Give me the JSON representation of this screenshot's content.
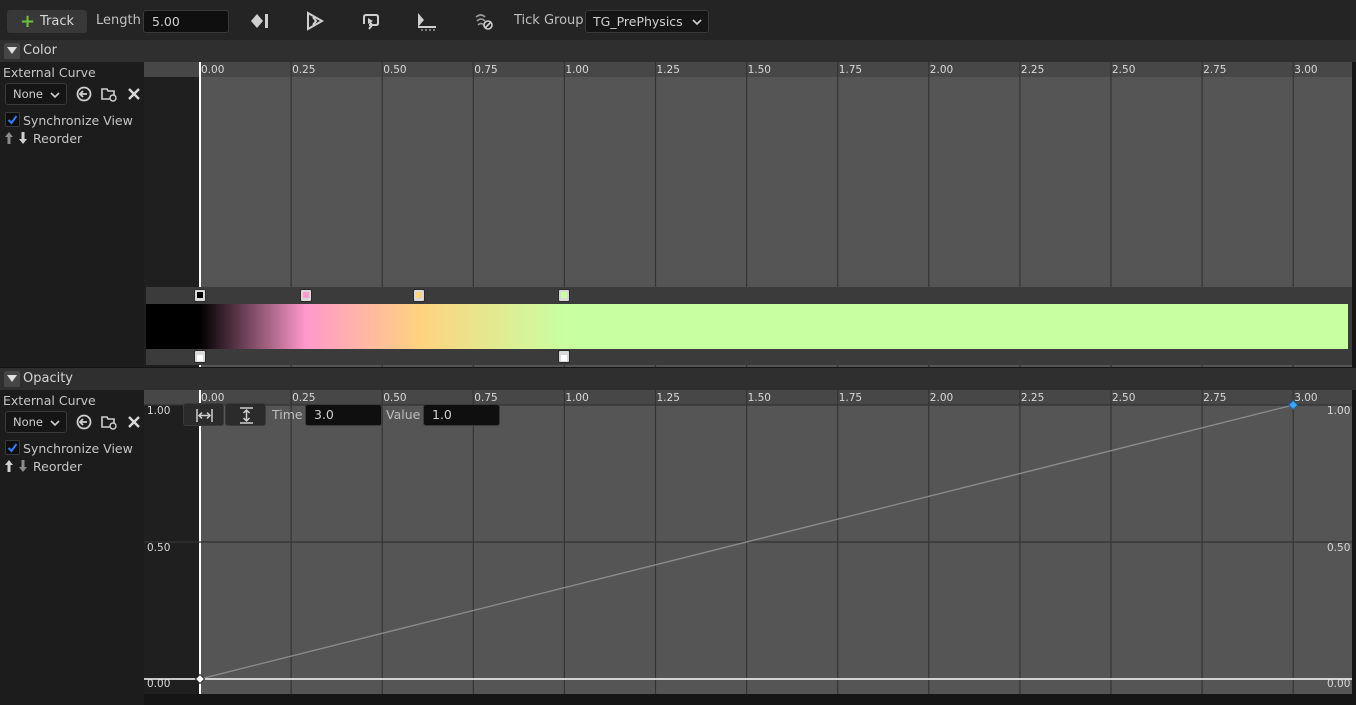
{
  "toolbar": {
    "track_label": "Track",
    "length_label": "Length",
    "length_value": "5.00",
    "tick_group_label": "Tick Group",
    "tick_group_value": "TG_PrePhysics",
    "icons": [
      "add-key-icon",
      "autoplay-icon",
      "loop-icon",
      "use-last-keyframe-icon",
      "ignore-time-dilation-icon"
    ]
  },
  "sections": {
    "color": {
      "title": "Color",
      "external_curve_label": "External Curve",
      "curve_value": "None",
      "sync_label": "Synchronize View",
      "sync_checked": true,
      "reorder_label": "Reorder",
      "gradient_stops": [
        {
          "time": 0.0,
          "color": "#000000"
        },
        {
          "time": 0.29,
          "color": "#ff99cc"
        },
        {
          "time": 0.6,
          "color": "#ffd27f"
        },
        {
          "time": 1.0,
          "color": "#c8ffa0"
        }
      ],
      "alpha_stops": [
        {
          "time": 0.0,
          "alpha": 1.0
        },
        {
          "time": 1.0,
          "alpha": 1.0
        }
      ]
    },
    "opacity": {
      "title": "Opacity",
      "external_curve_label": "External Curve",
      "curve_value": "None",
      "sync_label": "Synchronize View",
      "sync_checked": true,
      "reorder_label": "Reorder",
      "key_editor": {
        "time_label": "Time",
        "time_value": "3.0",
        "value_label": "Value",
        "value_value": "1.0"
      },
      "value_labels": [
        "1.00",
        "0.50",
        "0.00"
      ]
    }
  },
  "timeline": {
    "ticks": [
      "0.00",
      "0.25",
      "0.50",
      "0.75",
      "1.00",
      "1.25",
      "1.50",
      "1.75",
      "2.00",
      "2.25",
      "2.50",
      "2.75",
      "3.00"
    ]
  },
  "chart_data": {
    "type": "line",
    "series": [
      {
        "x": [
          0.0,
          3.0
        ],
        "y": [
          0.0,
          1.0
        ]
      }
    ],
    "xlim": [
      0.0,
      3.0
    ],
    "ylim": [
      0.0,
      1.0
    ]
  },
  "colors": {
    "accent_green": "#6fbf3b",
    "check_blue": "#2a7fff",
    "key_selected": "#3aa7ff"
  }
}
